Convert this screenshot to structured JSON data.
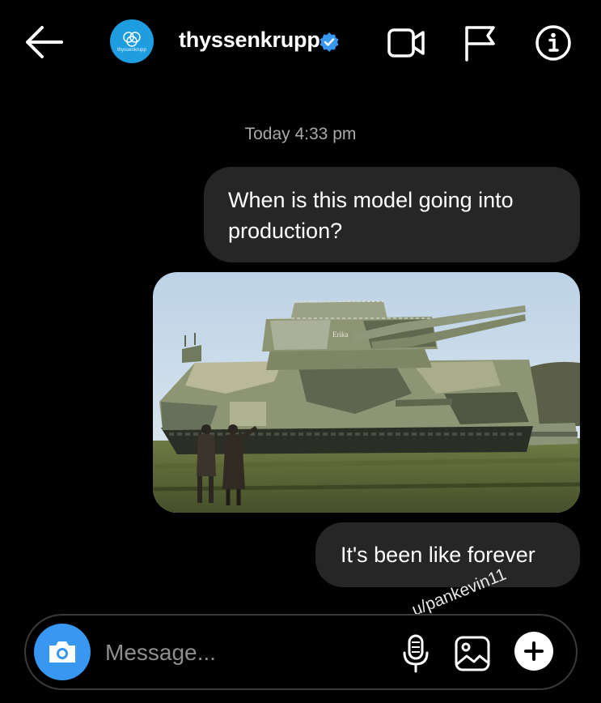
{
  "header": {
    "title": "thyssenkrupp",
    "avatar_text": "thyssenkrupp",
    "icons": [
      "back-arrow-icon",
      "verified-badge-icon",
      "video-call-icon",
      "flag-icon",
      "info-icon"
    ]
  },
  "thread": {
    "timestamp": "Today 4:33 pm",
    "messages": [
      {
        "type": "text",
        "text": "When is this model going into production?"
      },
      {
        "type": "image",
        "subject": "tank photo"
      },
      {
        "type": "text",
        "text": "It's been like forever"
      }
    ]
  },
  "image_overlay": {
    "turret_text": "Erika"
  },
  "watermark": "u/pankevin11",
  "composer": {
    "placeholder": "Message...",
    "icons": [
      "camera-icon",
      "microphone-icon",
      "gallery-icon",
      "plus-icon"
    ]
  },
  "colors": {
    "background": "#000000",
    "bubble": "#262626",
    "accent": "#3897f0",
    "verified": "#3897f0",
    "muted_text": "#a8a8a8"
  }
}
